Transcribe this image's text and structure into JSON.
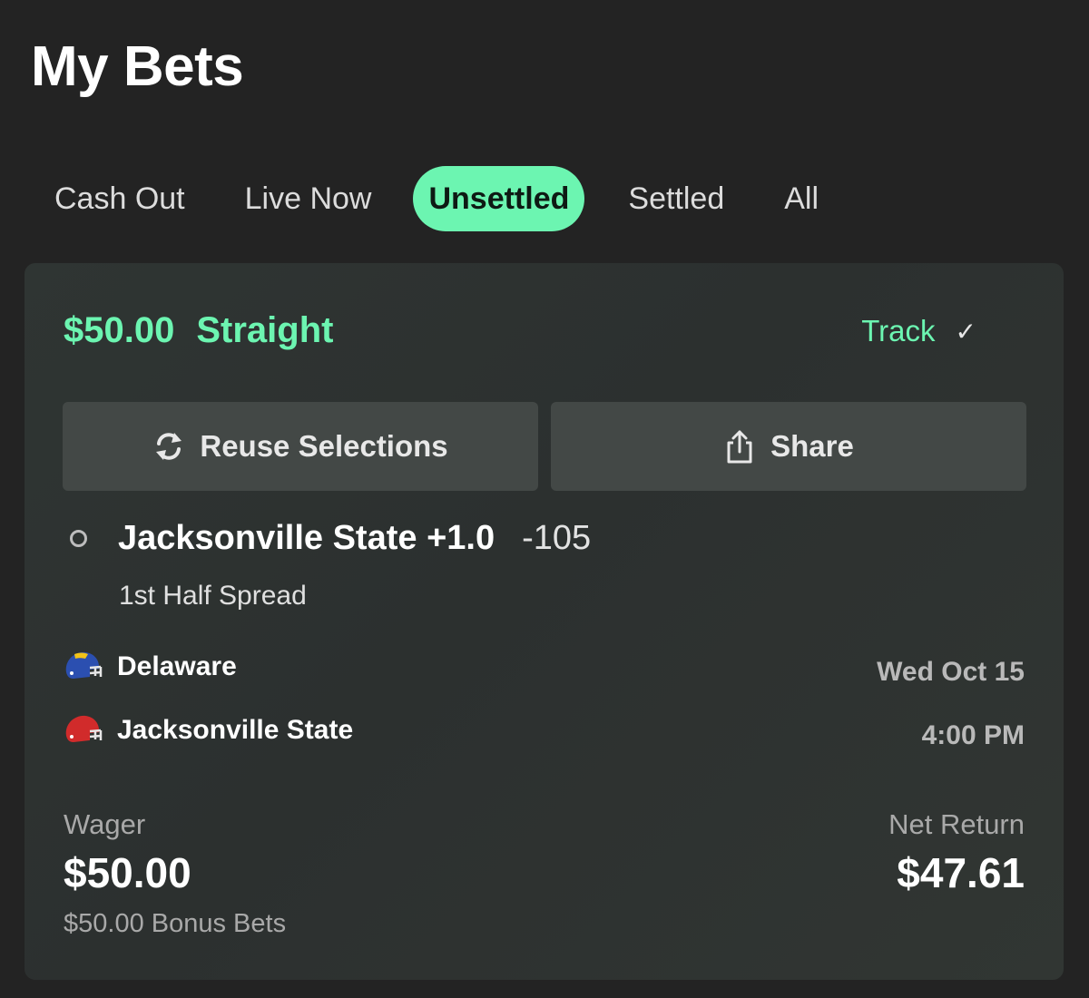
{
  "header": {
    "title": "My Bets"
  },
  "tabs": [
    {
      "label": "Cash Out"
    },
    {
      "label": "Live Now"
    },
    {
      "label": "Unsettled",
      "active": true
    },
    {
      "label": "Settled"
    },
    {
      "label": "All"
    }
  ],
  "bet": {
    "amount": "$50.00",
    "type": "Straight",
    "track_label": "Track",
    "track_icon": "checkmark-icon",
    "reuse_label": "Reuse Selections",
    "reuse_icon": "refresh-icon",
    "share_label": "Share",
    "share_icon": "share-icon",
    "selection": {
      "name": "Jacksonville State +1.0",
      "odds": "-105",
      "market": "1st Half Spread"
    },
    "game": {
      "teams": [
        {
          "name": "Delaware",
          "icon": "helmet-icon",
          "color": "#2b4fb0"
        },
        {
          "name": "Jacksonville State",
          "icon": "helmet-icon",
          "color": "#d12b2b"
        }
      ],
      "date": "Wed Oct 15",
      "time": "4:00 PM"
    },
    "wager_label": "Wager",
    "wager_amount": "$50.00",
    "bonus_text": "$50.00 Bonus Bets",
    "return_label": "Net Return",
    "return_amount": "$47.61"
  },
  "colors": {
    "accent": "#6cf5b1",
    "background": "#232323",
    "card": "#2f3533",
    "button": "#434846"
  }
}
